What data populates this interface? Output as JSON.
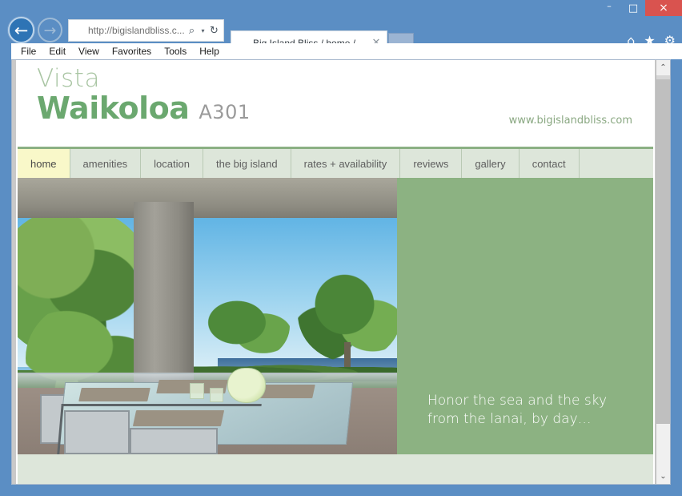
{
  "window": {
    "caption": {
      "minimize_label": "–",
      "maximize_label": "□",
      "close_label": "×"
    }
  },
  "browser": {
    "back_label": "←",
    "forward_label": "→",
    "address": {
      "favicon": "leaf-favicon",
      "url_text": "http://bigislandbliss.c...",
      "search_icon": "⌕",
      "caret_icon": "▾",
      "refresh_icon": "↻"
    },
    "tab": {
      "favicon": "leaf-favicon",
      "title": "Big Island Bliss / home /",
      "close_label": "✕"
    },
    "new_tab_label": "",
    "toolbar_icons": [
      {
        "name": "home-icon",
        "glyph": "⌂"
      },
      {
        "name": "favorites-star-icon",
        "glyph": "★"
      },
      {
        "name": "settings-gear-icon",
        "glyph": "⚙"
      }
    ],
    "menu": [
      {
        "label": "File"
      },
      {
        "label": "Edit"
      },
      {
        "label": "View"
      },
      {
        "label": "Favorites"
      },
      {
        "label": "Tools"
      },
      {
        "label": "Help"
      }
    ],
    "scrollbar": {
      "up_arrow": "⌃",
      "down_arrow": "⌄"
    }
  },
  "site": {
    "logo": {
      "line1": "Vista",
      "line2": "Waikoloa",
      "unit": "A301"
    },
    "url": "www.bigislandbliss.com",
    "nav": [
      {
        "label": "home",
        "active": true
      },
      {
        "label": "amenities",
        "active": false
      },
      {
        "label": "location",
        "active": false
      },
      {
        "label": "the big island",
        "active": false
      },
      {
        "label": "rates + availability",
        "active": false
      },
      {
        "label": "reviews",
        "active": false
      },
      {
        "label": "gallery",
        "active": false
      },
      {
        "label": "contact",
        "active": false
      }
    ],
    "hero": {
      "photo_alt": "lanai-dining-table-ocean-view-photo",
      "tagline_line1": "Honor the sea and the sky",
      "tagline_line2": "from the lanai, by day…"
    }
  },
  "colors": {
    "brand_green": "#8cb282",
    "logo_green": "#6ba86f",
    "logo_light_green": "#a9c5a3",
    "nav_tab_bg": "#dde6da",
    "active_tab_bg": "#f9f8c9",
    "chrome_blue": "#5b8ec4",
    "close_red": "#d9534f"
  }
}
